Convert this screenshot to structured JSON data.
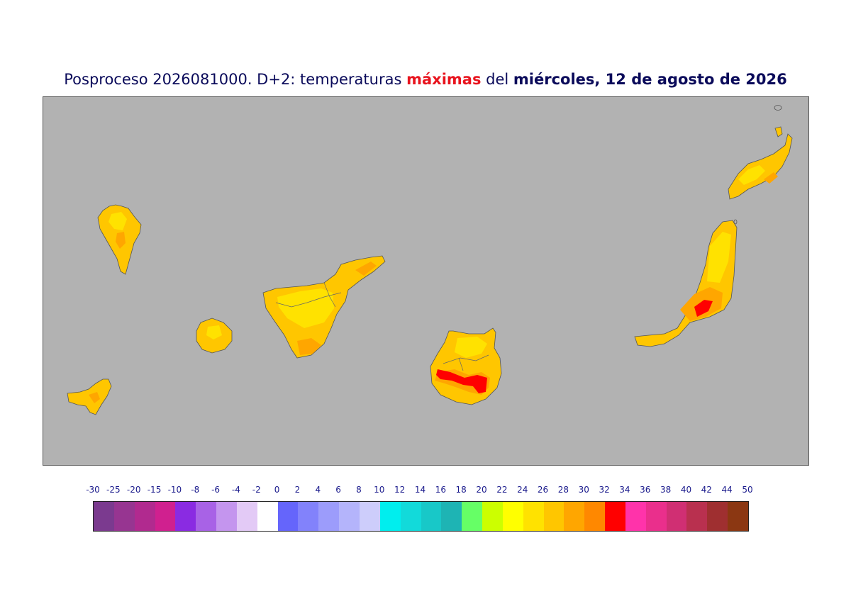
{
  "title": {
    "prefix": "Posproceso 2026081000. D+2: temperaturas ",
    "highlight": "máximas",
    "middle": " del ",
    "date": "miércoles, 12 de agosto de 2026"
  },
  "colors": {
    "title_text": "#0a0a5a",
    "highlight": "#e8141e",
    "ocean": "#b2b2b2"
  },
  "legend": {
    "ticks": [
      "-30",
      "-25",
      "-20",
      "-15",
      "-10",
      "-8",
      "-6",
      "-4",
      "-2",
      "0",
      "2",
      "4",
      "6",
      "8",
      "10",
      "12",
      "14",
      "16",
      "18",
      "20",
      "22",
      "24",
      "26",
      "28",
      "30",
      "32",
      "34",
      "36",
      "38",
      "40",
      "42",
      "44",
      "50"
    ],
    "colors": [
      "#7b3a8f",
      "#973591",
      "#b12a8f",
      "#d0208f",
      "#8a2be2",
      "#a862e6",
      "#c495ee",
      "#e3caf6",
      "#ffffff",
      "#6565fb",
      "#8282fb",
      "#9c9cfb",
      "#b4b4fb",
      "#cdcdfb",
      "#00eeee",
      "#12dada",
      "#18c8c8",
      "#1eb4b4",
      "#66ff66",
      "#ccff00",
      "#ffff00",
      "#ffe200",
      "#ffc600",
      "#ffa600",
      "#ff8800",
      "#ff0000",
      "#ff33aa",
      "#ea2f8c",
      "#d02f73",
      "#b9304f",
      "#9f2f30",
      "#8b3712"
    ]
  },
  "islands": [
    {
      "name": "La Palma"
    },
    {
      "name": "El Hierro"
    },
    {
      "name": "La Gomera"
    },
    {
      "name": "Tenerife"
    },
    {
      "name": "Gran Canaria"
    },
    {
      "name": "Fuerteventura"
    },
    {
      "name": "Lanzarote"
    }
  ]
}
